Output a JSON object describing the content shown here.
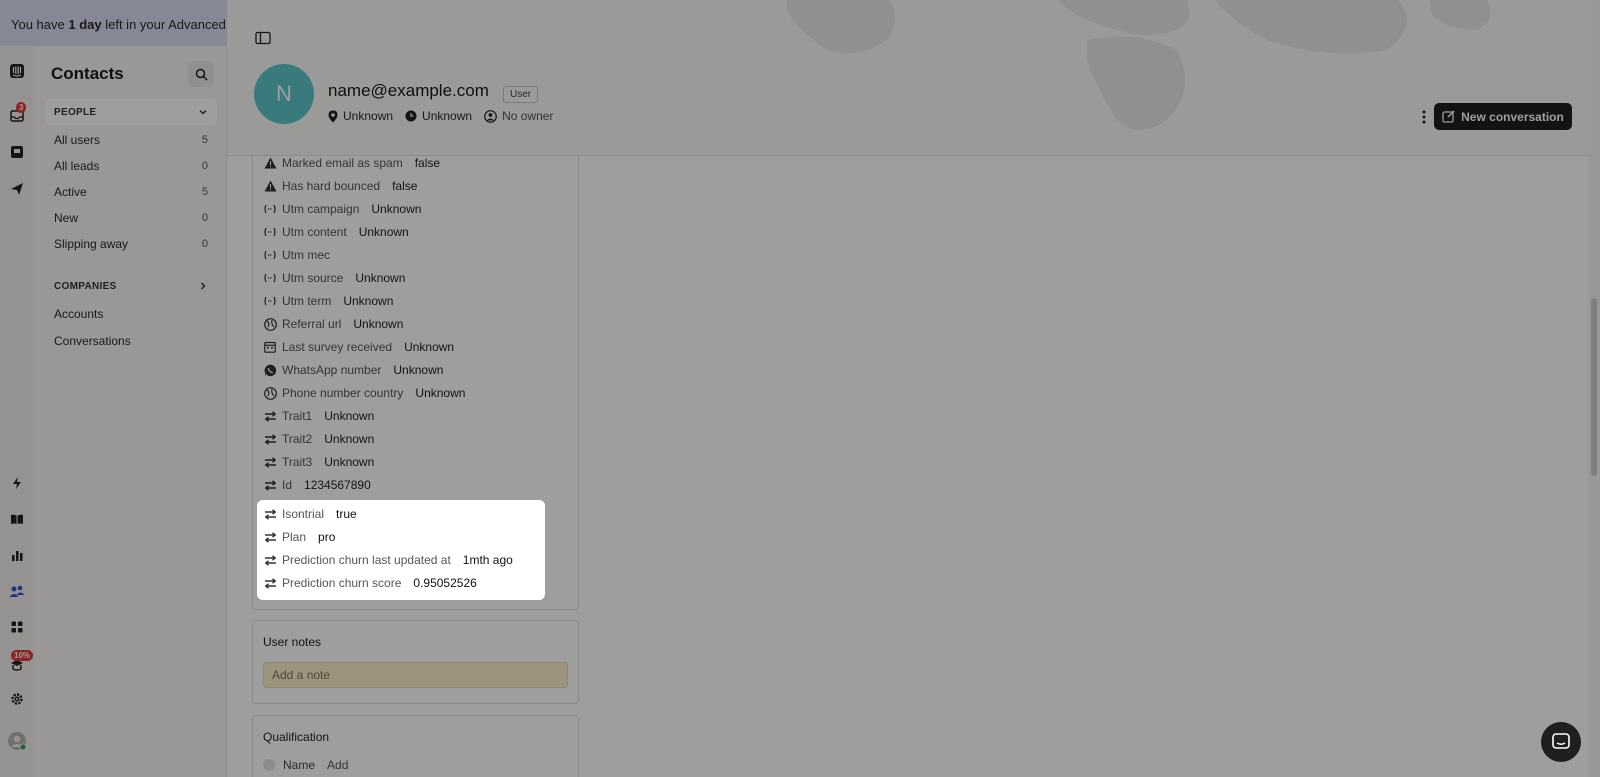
{
  "banner": {
    "pre": "You have ",
    "bold": "1 day",
    "post": " left in your Advanced trial"
  },
  "rail": {
    "inbox_badge": "3",
    "academy_badge": "10%",
    "icons": [
      "intercom-logo-icon",
      "inbox-icon",
      "fin-icon",
      "outbound-icon",
      "operator-icon",
      "knowledge-icon",
      "reports-icon",
      "contacts-icon",
      "apps-icon",
      "academy-icon",
      "settings-icon",
      "profile-avatar-icon"
    ]
  },
  "sidebar": {
    "title": "Contacts",
    "people_section": "PEOPLE",
    "people_items": [
      {
        "label": "All users",
        "count": "5"
      },
      {
        "label": "All leads",
        "count": "0"
      },
      {
        "label": "Active",
        "count": "5"
      },
      {
        "label": "New",
        "count": "0"
      },
      {
        "label": "Slipping away",
        "count": "0"
      }
    ],
    "companies_section": "COMPANIES",
    "company_items": [
      {
        "label": "Accounts"
      },
      {
        "label": "Conversations"
      }
    ]
  },
  "header": {
    "avatar_initial": "N",
    "avatar_color": "#5cc6c9",
    "name": "name@example.com",
    "role": "User",
    "location": "Unknown",
    "timezone": "Unknown",
    "owner": "No owner",
    "new_conversation": "New conversation"
  },
  "attributes": [
    {
      "icon": "warning-icon",
      "label": "Marked email as spam",
      "value": "false"
    },
    {
      "icon": "warning-icon",
      "label": "Has hard bounced",
      "value": "false"
    },
    {
      "icon": "utm-icon",
      "label": "Utm campaign",
      "value": "Unknown"
    },
    {
      "icon": "utm-icon",
      "label": "Utm content",
      "value": "Unknown"
    },
    {
      "icon": "utm-icon",
      "label": "Utm mec",
      "value": ""
    },
    {
      "icon": "utm-icon",
      "label": "Utm source",
      "value": "Unknown"
    },
    {
      "icon": "utm-icon",
      "label": "Utm term",
      "value": "Unknown"
    },
    {
      "icon": "globe-icon",
      "label": "Referral url",
      "value": "Unknown"
    },
    {
      "icon": "calendar-icon",
      "label": "Last survey received",
      "value": "Unknown"
    },
    {
      "icon": "whatsapp-icon",
      "label": "WhatsApp number",
      "value": "Unknown"
    },
    {
      "icon": "globe-icon",
      "label": "Phone number country",
      "value": "Unknown"
    },
    {
      "icon": "custom-attribute-icon",
      "label": "Trait1",
      "value": "Unknown"
    },
    {
      "icon": "custom-attribute-icon",
      "label": "Trait2",
      "value": "Unknown"
    },
    {
      "icon": "custom-attribute-icon",
      "label": "Trait3",
      "value": "Unknown"
    },
    {
      "icon": "custom-attribute-icon",
      "label": "Id",
      "value": "1234567890"
    }
  ],
  "highlighted_attributes": [
    {
      "icon": "custom-attribute-icon",
      "label": "Isontrial",
      "value": "true"
    },
    {
      "icon": "custom-attribute-icon",
      "label": "Plan",
      "value": "pro"
    },
    {
      "icon": "custom-attribute-icon",
      "label": "Prediction churn last updated at",
      "value": "1mth ago"
    },
    {
      "icon": "custom-attribute-icon",
      "label": "Prediction churn score",
      "value": "0.95052526"
    }
  ],
  "notes": {
    "title": "User notes",
    "placeholder": "Add a note"
  },
  "qualification": {
    "title": "Qualification",
    "rows": [
      {
        "label": "Name",
        "value": "Add"
      }
    ]
  }
}
